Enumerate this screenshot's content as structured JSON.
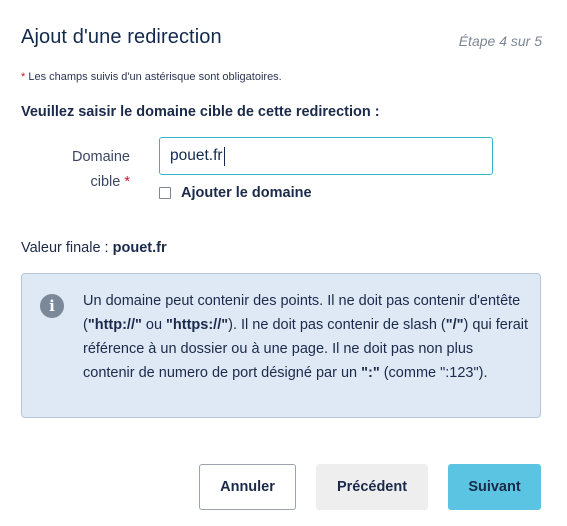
{
  "header": {
    "title": "Ajout d'une redirection",
    "step": "Étape 4 sur 5"
  },
  "form": {
    "required_star": "*",
    "required_note": " Les champs suivis d'un astérisque sont obligatoires.",
    "section_heading": "Veuillez saisir le domaine cible de cette redirection :",
    "field_label_line1": "Domaine",
    "field_label_line2": "cible",
    "field_star": "*",
    "domain_value": "pouet.fr",
    "checkbox_label": "Ajouter le domaine",
    "checkbox_checked": false,
    "final_value_label": "Valeur finale :",
    "final_value": "pouet.fr"
  },
  "info": {
    "icon": "info-icon",
    "icon_glyph": "i",
    "text_1": "Un domaine peut contenir des points. Il ne doit pas contenir d'entête (",
    "bold_1": "\"http://\"",
    "text_2": " ou ",
    "bold_2": "\"https://\"",
    "text_3": "). Il ne doit pas contenir de slash (",
    "bold_3": "\"/\"",
    "text_4": ") qui ferait référence à un dossier ou à une page. Il ne doit pas non plus contenir de numero de port désigné par un ",
    "bold_4": "\":\"",
    "text_5": " (comme \":123\")."
  },
  "actions": {
    "cancel_label": "Annuler",
    "prev_label": "Précédent",
    "next_label": "Suivant"
  },
  "colors": {
    "accent": "#5cc4e3",
    "input_border": "#36b5cc",
    "required": "#d0142a",
    "info_bg": "#dfe9f6"
  }
}
